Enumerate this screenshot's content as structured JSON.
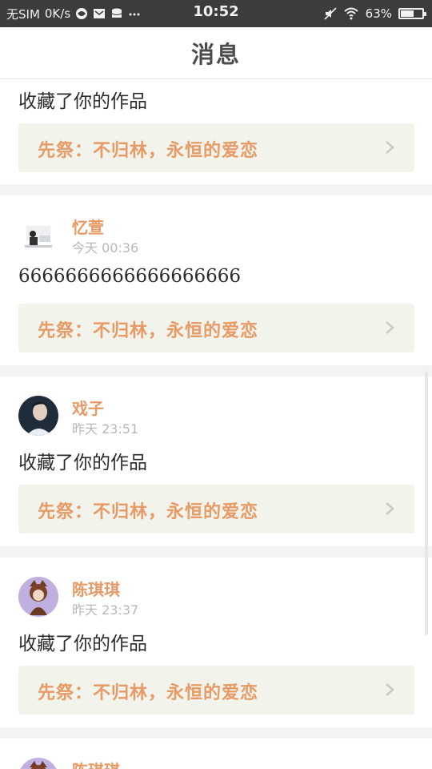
{
  "status_bar": {
    "carrier": "无SIM",
    "net_speed": "0K/s",
    "time": "10:52",
    "battery_percent": "63%",
    "battery_level": 0.63,
    "icons": [
      "browser-icon",
      "mail-icon",
      "storage-icon",
      "more-dots-icon",
      "mute-icon",
      "wifi-icon",
      "battery-icon"
    ]
  },
  "header": {
    "title": "消息"
  },
  "feed": [
    {
      "partial": true,
      "message": "收藏了你的作品",
      "work_title": "先祭：不归林，永恒的爱恋"
    },
    {
      "username": "忆萱",
      "timestamp": "今天 00:36",
      "message": "6666666666666666666",
      "work_title": "先祭：不归林，永恒的爱恋"
    },
    {
      "username": "戏子",
      "timestamp": "昨天 23:51",
      "message": "收藏了你的作品",
      "work_title": "先祭：不归林，永恒的爱恋"
    },
    {
      "username": "陈琪琪",
      "timestamp": "昨天 23:37",
      "message": "收藏了你的作品",
      "work_title": "先祭：不归林，永恒的爱恋"
    },
    {
      "username": "陈琪琪"
    }
  ],
  "colors": {
    "accent": "#e89a66",
    "status_bar_bg": "#3b3c3b",
    "link_bg": "#f2f3ea",
    "page_bg": "#f3f3f1"
  }
}
